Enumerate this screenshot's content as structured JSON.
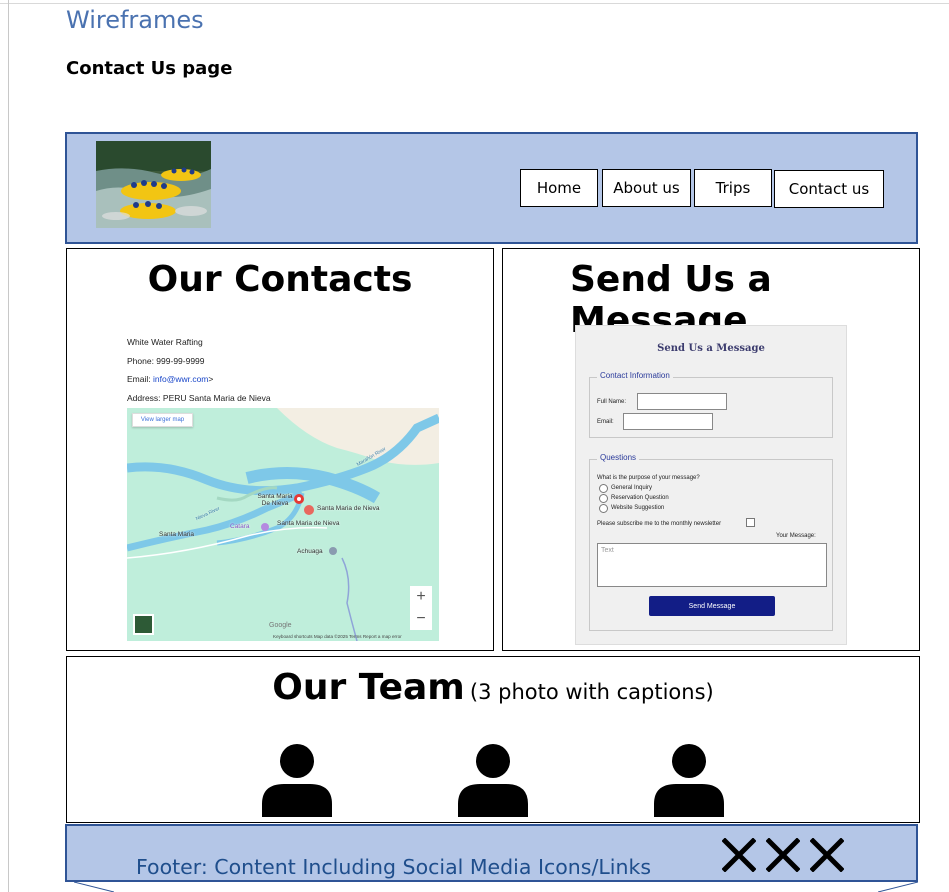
{
  "document": {
    "heading": "Wireframes",
    "subheading": "Contact Us page"
  },
  "header": {
    "nav": {
      "home": "Home",
      "about": "About us",
      "trips": "Trips",
      "contact": "Contact us"
    }
  },
  "contacts": {
    "title": "Our Contacts",
    "company": "White Water Rafting",
    "phone": "Phone: 999-99-9999",
    "email_prefix": "Email: ",
    "email_link": "info@wwr.com",
    "email_suffix": ">",
    "address": "Address: PERU Santa Maria de Nieva",
    "map": {
      "larger_map": "View larger map",
      "labels": {
        "santa_maria_de_nieva_town": "Santa Maria De Nieva",
        "santa_maria_de_nieva_poi": "Santa Maria de Nieva",
        "santa_maria_de_nieva_place": "Santa Maria de Nieva",
        "santa_maria": "Santa Maria",
        "catarata": "Catara",
        "achuaga": "Achuaga",
        "marañon_river": "Marañón River",
        "nieva_river": "Nieva River"
      },
      "zoom_in": "+",
      "zoom_out": "−",
      "google": "Google",
      "footer": "Keyboard shortcuts   Map data ©2025   Terms   Report a map error"
    }
  },
  "message": {
    "title": "Send Us a Message",
    "form": {
      "title": "Send Us a Message",
      "contact_legend": "Contact Information",
      "full_name_label": "Full Name:",
      "email_label": "Email:",
      "questions_legend": "Questions",
      "purpose_question": "What is the purpose of your message?",
      "options": [
        "General Inquiry",
        "Reservation Question",
        "Website Suggestion"
      ],
      "newsletter_label": "Please subscribe me to the monthly newsletter",
      "your_message_label": "Your Message:",
      "textarea_placeholder": "Text",
      "send_button": "Send Message"
    }
  },
  "team": {
    "title": "Our Team",
    "caption": "(3 photo with captions)",
    "member_icons": [
      "person-icon",
      "person-icon",
      "person-icon"
    ]
  },
  "footer": {
    "text": "Footer: Content Including Social Media Icons/Links",
    "social_icons": [
      "x-icon",
      "x-icon",
      "x-icon"
    ]
  },
  "colors": {
    "header_bg": "#b4c6e7",
    "header_border": "#2f5496",
    "heading_blue": "#4a72b0",
    "send_button": "#121d86"
  }
}
